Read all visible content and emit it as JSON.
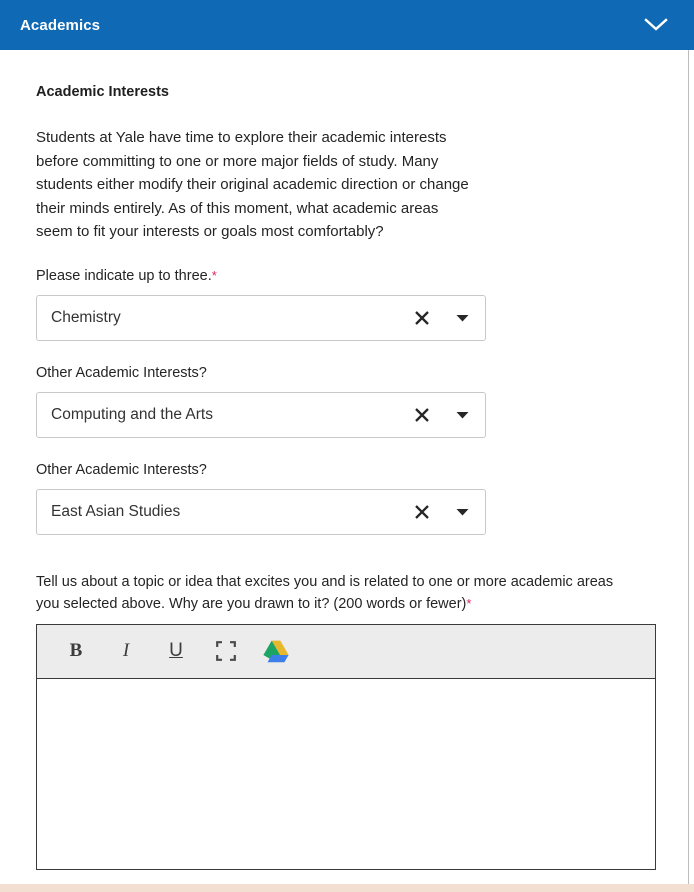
{
  "header": {
    "title": "Academics",
    "collapse_icon": "chevron-down-icon"
  },
  "section": {
    "title": "Academic Interests",
    "intro": "Students at Yale have time to explore their academic interests before committing to one or more major fields of study. Many students either modify their original academic direction or change their minds entirely. As of this moment, what academic areas seem to fit your interests or goals most comfortably?"
  },
  "fields": [
    {
      "label": "Please indicate up to three.",
      "required": true,
      "required_marker": "*",
      "value": "Chemistry",
      "clear_icon": "close-icon",
      "caret_icon": "caret-down-icon"
    },
    {
      "label": "Other Academic Interests?",
      "required": false,
      "required_marker": "",
      "value": "Computing and the Arts",
      "clear_icon": "close-icon",
      "caret_icon": "caret-down-icon"
    },
    {
      "label": "Other Academic Interests?",
      "required": false,
      "required_marker": "",
      "value": "East Asian Studies",
      "clear_icon": "close-icon",
      "caret_icon": "caret-down-icon"
    }
  ],
  "essay": {
    "prompt": "Tell us about a topic or idea that excites you and is related to one or more academic areas you selected above. Why are you drawn to it?  (200 words or fewer)",
    "required_marker": "*",
    "body_value": "",
    "toolbar": {
      "bold_label": "B",
      "italic_label": "I",
      "underline_label": "U",
      "fullscreen_icon": "fullscreen-icon",
      "drive_icon": "google-drive-icon"
    }
  },
  "colors": {
    "header_blue": "#1069b4",
    "required_red": "#d6285a",
    "toolbar_grey": "#ececec",
    "drive_green": "#1DA462",
    "drive_yellow": "#E9B72B",
    "drive_blue": "#3D7FE8",
    "bottom_strip": "#f3ded2"
  }
}
